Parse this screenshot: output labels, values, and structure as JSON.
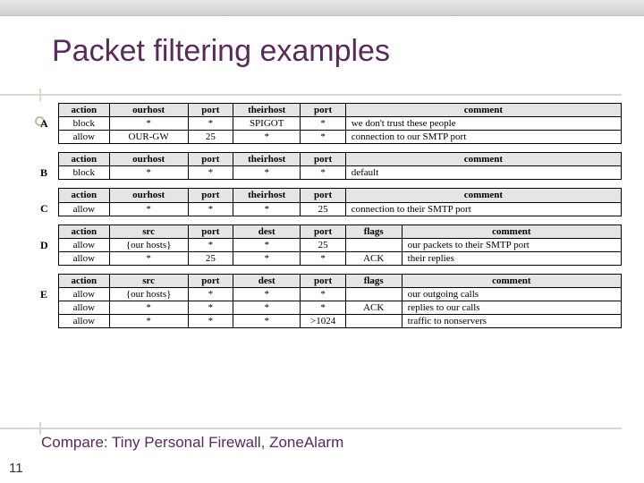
{
  "title": "Packet filtering examples",
  "footnote": "Compare: Tiny Personal Firewall, ZoneAlarm",
  "page_number": "11",
  "tables": {
    "A": {
      "headers": [
        "action",
        "ourhost",
        "port",
        "theirhost",
        "port",
        "comment"
      ],
      "rows": [
        [
          "block",
          "*",
          "*",
          "SPIGOT",
          "*",
          "we don't trust these people"
        ],
        [
          "allow",
          "OUR-GW",
          "25",
          "*",
          "*",
          "connection to our SMTP port"
        ]
      ]
    },
    "B": {
      "headers": [
        "action",
        "ourhost",
        "port",
        "theirhost",
        "port",
        "comment"
      ],
      "rows": [
        [
          "block",
          "*",
          "*",
          "*",
          "*",
          "default"
        ]
      ]
    },
    "C": {
      "headers": [
        "action",
        "ourhost",
        "port",
        "theirhost",
        "port",
        "comment"
      ],
      "rows": [
        [
          "allow",
          "*",
          "*",
          "*",
          "25",
          "connection to their SMTP port"
        ]
      ]
    },
    "D": {
      "headers": [
        "action",
        "src",
        "port",
        "dest",
        "port",
        "flags",
        "comment"
      ],
      "rows": [
        [
          "allow",
          "{our hosts}",
          "*",
          "*",
          "25",
          "",
          "our packets to their SMTP port"
        ],
        [
          "allow",
          "*",
          "25",
          "*",
          "*",
          "ACK",
          "their replies"
        ]
      ]
    },
    "E": {
      "headers": [
        "action",
        "src",
        "port",
        "dest",
        "port",
        "flags",
        "comment"
      ],
      "rows": [
        [
          "allow",
          "{our hosts}",
          "*",
          "*",
          "*",
          "",
          "our outgoing calls"
        ],
        [
          "allow",
          "*",
          "*",
          "*",
          "*",
          "ACK",
          "replies to our calls"
        ],
        [
          "allow",
          "*",
          "*",
          "*",
          ">1024",
          "",
          "traffic to nonservers"
        ]
      ]
    }
  }
}
